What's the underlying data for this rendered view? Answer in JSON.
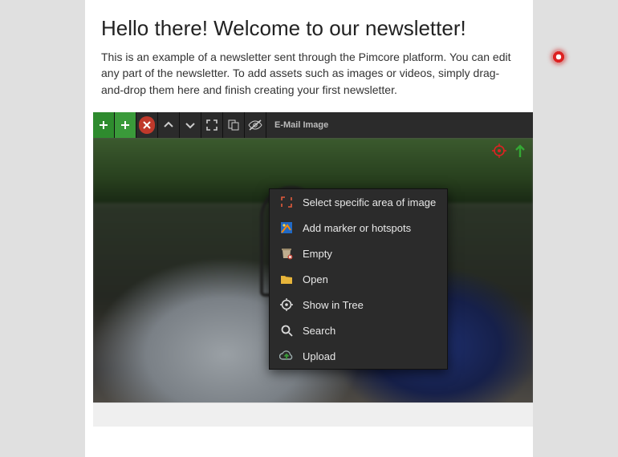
{
  "header": {
    "title": "Hello there! Welcome to our newsletter!",
    "intro": "This is an example of a newsletter sent through the Pimcore platform. You can edit any part of the newsletter. To add assets such as images or videos, simply drag-and-drop them here and finish creating your first newsletter."
  },
  "toolbar": {
    "label": "E-Mail Image"
  },
  "corner": {
    "hotspot_color": "#d22",
    "arrow_color": "#2e8b2e"
  },
  "context_menu": {
    "items": [
      {
        "id": "select-area",
        "label": "Select specific area of image"
      },
      {
        "id": "add-marker",
        "label": "Add marker or hotspots"
      },
      {
        "id": "empty",
        "label": "Empty"
      },
      {
        "id": "open",
        "label": "Open"
      },
      {
        "id": "show-in-tree",
        "label": "Show in Tree"
      },
      {
        "id": "search",
        "label": "Search"
      },
      {
        "id": "upload",
        "label": "Upload"
      }
    ]
  }
}
